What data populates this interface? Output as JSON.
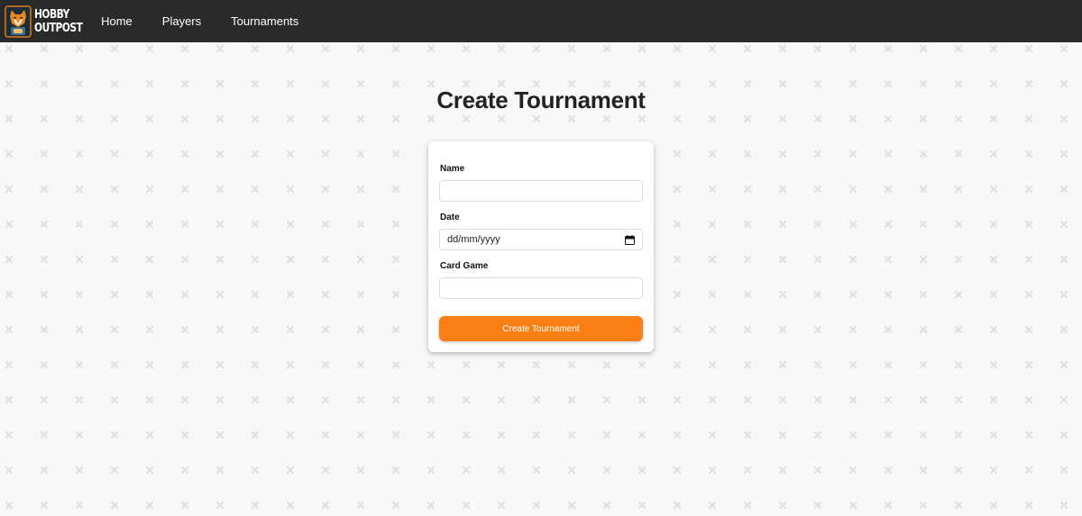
{
  "nav": {
    "brand_line1": "HOBBY",
    "brand_line2": "OUTPOST",
    "links": [
      {
        "label": "Home"
      },
      {
        "label": "Players"
      },
      {
        "label": "Tournaments"
      }
    ]
  },
  "page": {
    "title": "Create Tournament"
  },
  "form": {
    "name": {
      "label": "Name",
      "value": "",
      "placeholder": ""
    },
    "date": {
      "label": "Date",
      "value": "dd/mm/yyyy"
    },
    "card_game": {
      "label": "Card Game",
      "value": "",
      "placeholder": ""
    },
    "submit_label": "Create Tournament"
  },
  "colors": {
    "nav_bg": "#2a2a2a",
    "accent": "#f97f14",
    "page_bg": "#f8f8f8",
    "pattern": "#e2e2e2"
  },
  "icons": {
    "brand": "fox-logo-icon",
    "date_picker": "calendar-icon",
    "background": "x-pattern-icon"
  }
}
